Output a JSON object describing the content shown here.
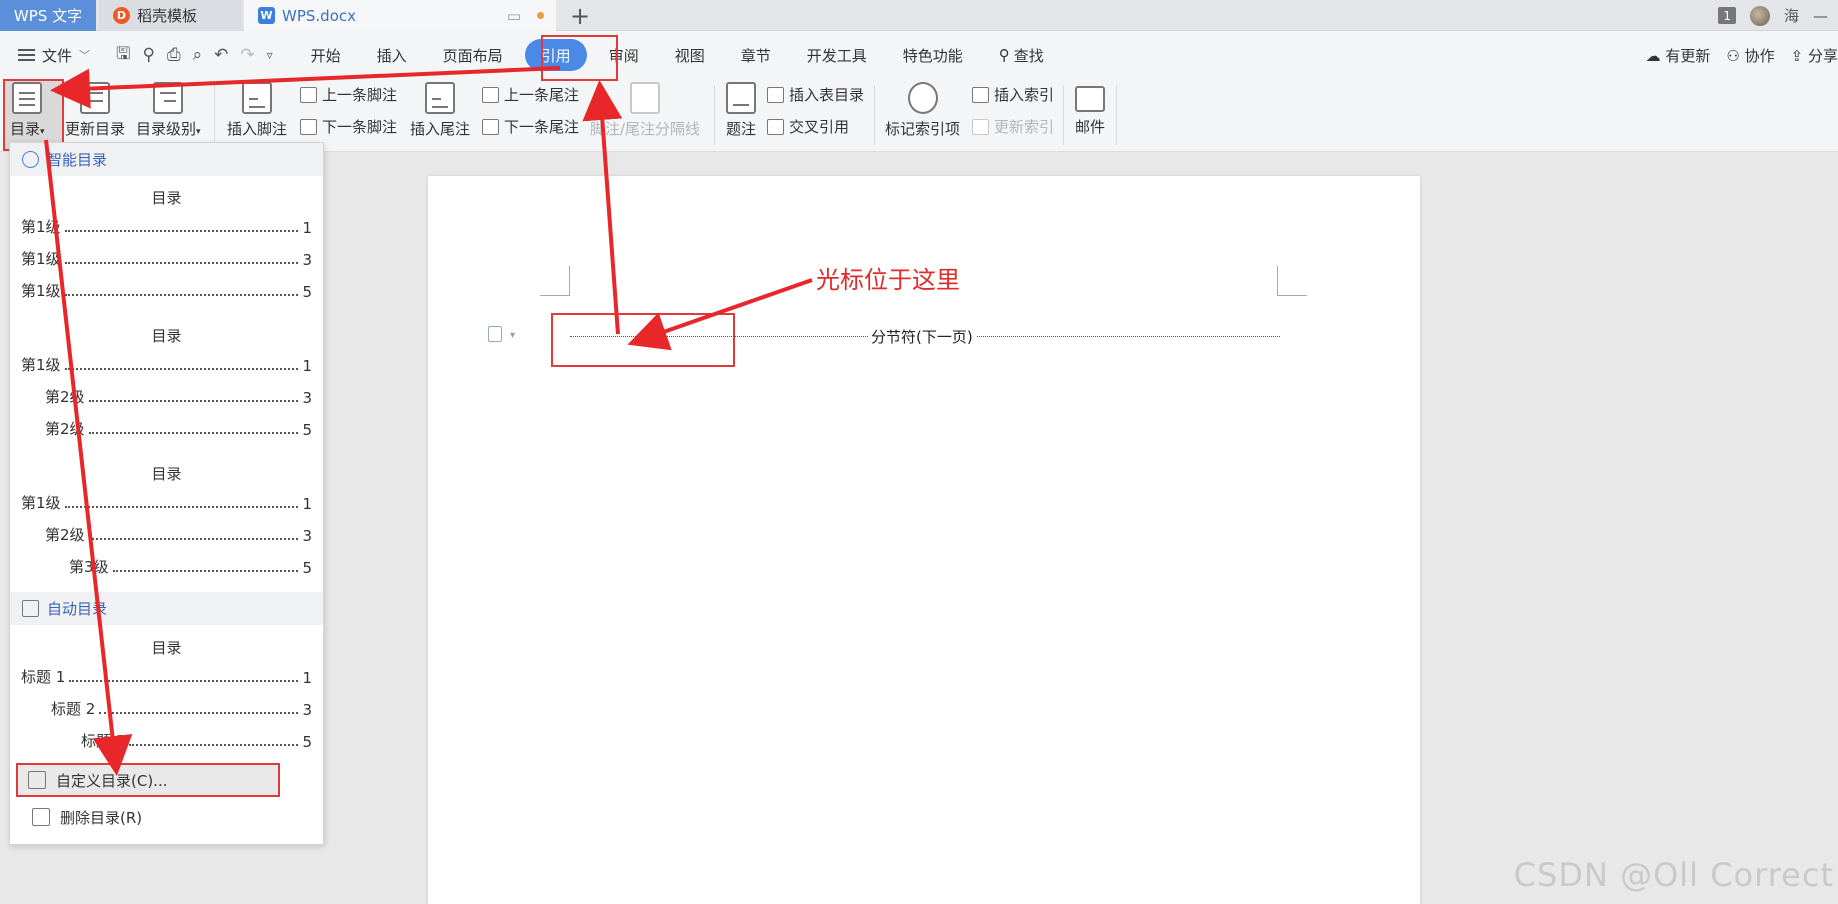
{
  "tabs": {
    "wps": "WPS 文字",
    "daoke": "稻壳模板",
    "doc": "WPS.docx",
    "badge": "1",
    "user": "海"
  },
  "menubar": {
    "file": "文件",
    "items": [
      "开始",
      "插入",
      "页面布局",
      "引用",
      "审阅",
      "视图",
      "章节",
      "开发工具",
      "特色功能",
      "查找"
    ],
    "right": [
      "有更新",
      "协作",
      "分享"
    ]
  },
  "ribbon": {
    "toc": "目录",
    "update_toc": "更新目录",
    "toc_level": "目录级别",
    "insert_footnote": "插入脚注",
    "prev_footnote": "上一条脚注",
    "next_footnote": "下一条脚注",
    "insert_endnote": "插入尾注",
    "prev_endnote": "上一条尾注",
    "next_endnote": "下一条尾注",
    "separator": "脚注/尾注分隔线",
    "caption": "题注",
    "insert_table_toc": "插入表目录",
    "cross_ref": "交叉引用",
    "mark_index": "标记索引项",
    "insert_index": "插入索引",
    "update_index": "更新索引",
    "mail": "邮件"
  },
  "dropdown": {
    "smart_section": "智能目录",
    "auto_section": "自动目录",
    "toc_title": "目录",
    "preset1": [
      {
        "label": "第1级",
        "page": "1"
      },
      {
        "label": "第1级",
        "page": "3"
      },
      {
        "label": "第1级",
        "page": "5"
      }
    ],
    "preset2": [
      {
        "label": "第1级",
        "page": "1"
      },
      {
        "label": "第2级",
        "page": "3"
      },
      {
        "label": "第2级",
        "page": "5"
      }
    ],
    "preset3": [
      {
        "label": "第1级",
        "page": "1"
      },
      {
        "label": "第2级",
        "page": "3"
      },
      {
        "label": "第3级",
        "page": "5"
      }
    ],
    "auto": [
      {
        "label": "标题 1",
        "page": "1"
      },
      {
        "label": "标题 2",
        "page": "3"
      },
      {
        "label": "标题 3",
        "page": "5"
      }
    ],
    "custom_toc": "自定义目录(C)...",
    "delete_toc": "删除目录(R)"
  },
  "document": {
    "section_break": "分节符(下一页)"
  },
  "annotation": "光标位于这里",
  "watermark": "CSDN @Oll Correct",
  "colors": {
    "accent": "#4a8ae6",
    "annotation_red": "#e02b2b",
    "wps_tab": "#5b8fd9"
  }
}
